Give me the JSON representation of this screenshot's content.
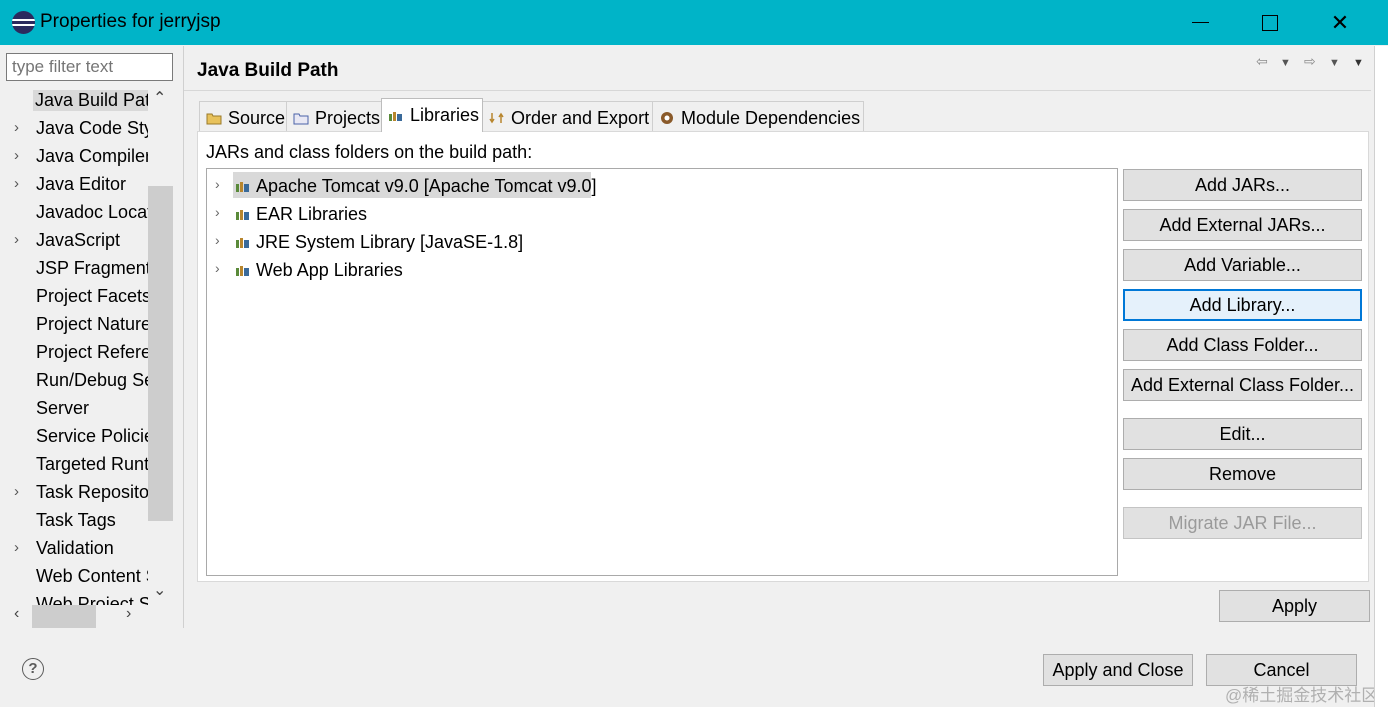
{
  "window": {
    "title": "Properties for jerryjsp",
    "colors": {
      "titlebar": "#00b4c8",
      "focus_border": "#0078d7"
    }
  },
  "nav": {
    "filter_placeholder": "type filter text",
    "items": [
      {
        "label": "Java Build Path",
        "expandable": false,
        "selected": true
      },
      {
        "label": "Java Code Style",
        "expandable": true
      },
      {
        "label": "Java Compiler",
        "expandable": true
      },
      {
        "label": "Java Editor",
        "expandable": true
      },
      {
        "label": "Javadoc Location",
        "expandable": false
      },
      {
        "label": "JavaScript",
        "expandable": true
      },
      {
        "label": "JSP Fragment",
        "expandable": false
      },
      {
        "label": "Project Facets",
        "expandable": false
      },
      {
        "label": "Project Natures",
        "expandable": false
      },
      {
        "label": "Project References",
        "expandable": false
      },
      {
        "label": "Run/Debug Settings",
        "expandable": false
      },
      {
        "label": "Server",
        "expandable": false
      },
      {
        "label": "Service Policies",
        "expandable": false
      },
      {
        "label": "Targeted Runtimes",
        "expandable": false
      },
      {
        "label": "Task Repository",
        "expandable": true
      },
      {
        "label": "Task Tags",
        "expandable": false
      },
      {
        "label": "Validation",
        "expandable": true
      },
      {
        "label": "Web Content Settings",
        "expandable": false
      },
      {
        "label": "Web Project Settings",
        "expandable": false
      }
    ]
  },
  "page": {
    "title": "Java Build Path",
    "tabs": [
      {
        "label": "Source",
        "icon": "source-folder-icon"
      },
      {
        "label": "Projects",
        "icon": "projects-icon"
      },
      {
        "label": "Libraries",
        "icon": "library-icon",
        "active": true
      },
      {
        "label": "Order and Export",
        "icon": "order-export-icon"
      },
      {
        "label": "Module Dependencies",
        "icon": "module-icon"
      }
    ],
    "panel_label": "JARs and class folders on the build path:",
    "libraries": [
      {
        "label": "Apache Tomcat v9.0 [Apache Tomcat v9.0]",
        "selected": true
      },
      {
        "label": "EAR Libraries"
      },
      {
        "label": "JRE System Library [JavaSE-1.8]"
      },
      {
        "label": "Web App Libraries"
      }
    ],
    "buttons": {
      "add_jars": "Add JARs...",
      "add_external_jars": "Add External JARs...",
      "add_variable": "Add Variable...",
      "add_library": "Add Library...",
      "add_class_folder": "Add Class Folder...",
      "add_external_class_folder": "Add External Class Folder...",
      "edit": "Edit...",
      "remove": "Remove",
      "migrate_jar": "Migrate JAR File..."
    },
    "apply": "Apply"
  },
  "footer": {
    "apply_and_close": "Apply and Close",
    "cancel": "Cancel",
    "watermark": "@稀土掘金技术社区"
  }
}
